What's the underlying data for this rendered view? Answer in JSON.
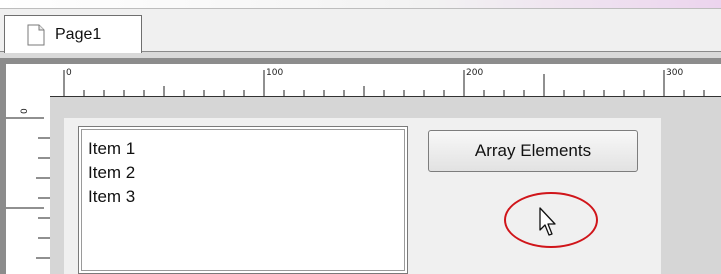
{
  "tab": {
    "label": "Page1",
    "icon": "document-icon"
  },
  "ruler": {
    "horizontal_labels": [
      "0",
      "100",
      "200",
      "300"
    ],
    "vertical_labels": [
      "0"
    ]
  },
  "form": {
    "listbox": {
      "items": [
        "Item 1",
        "Item 2",
        "Item 3"
      ]
    },
    "button": {
      "label": "Array Elements"
    },
    "cursor": {
      "icon": "mouse-pointer-icon",
      "highlight_color": "#d0151a"
    }
  }
}
